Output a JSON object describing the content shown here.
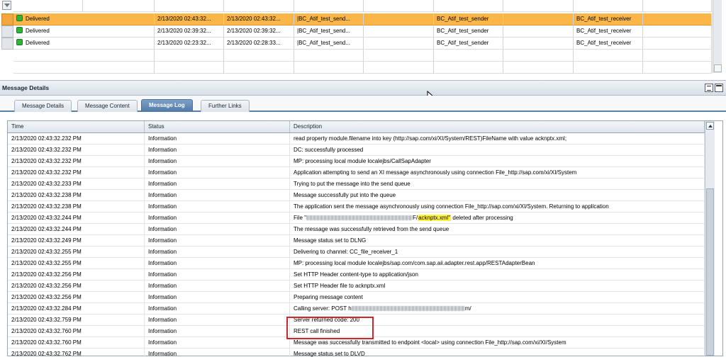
{
  "message_list": {
    "rows": [
      {
        "status": "Delivered",
        "start": "2/13/2020 02:43:32...",
        "end": "2/13/2020 02:43:32...",
        "interface": "|BC_Atif_test_send...",
        "sender": "BC_Atif_test_sender",
        "receiver": "BC_Atif_test_receiver",
        "selected": true
      },
      {
        "status": "Delivered",
        "start": "2/13/2020 02:39:32...",
        "end": "2/13/2020 02:39:32...",
        "interface": "|BC_Atif_test_send...",
        "sender": "BC_Atif_test_sender",
        "receiver": "BC_Atif_test_receiver",
        "selected": false
      },
      {
        "status": "Delivered",
        "start": "2/13/2020 02:23:32...",
        "end": "2/13/2020 02:28:33...",
        "interface": "|BC_Atif_test_send...",
        "sender": "BC_Atif_test_sender",
        "receiver": "BC_Atif_test_receiver",
        "selected": false
      }
    ]
  },
  "panel": {
    "title": "Message Details"
  },
  "tabs": [
    {
      "label": "Message Details",
      "active": false
    },
    {
      "label": "Message Content",
      "active": false
    },
    {
      "label": "Message Log",
      "active": true
    },
    {
      "label": "Further Links",
      "active": false
    }
  ],
  "log": {
    "headers": {
      "time": "Time",
      "status": "Status",
      "description": "Description"
    },
    "rows": [
      {
        "time": "2/13/2020 02:43:32.232 PM",
        "status": "Information",
        "desc": "read property module.filename into key (http://sap.com/xi/XI/System/REST)FileName with value acknptx.xml;"
      },
      {
        "time": "2/13/2020 02:43:32.232 PM",
        "status": "Information",
        "desc": "DC: successfully processed"
      },
      {
        "time": "2/13/2020 02:43:32.232 PM",
        "status": "Information",
        "desc": "MP: processing local module localejbs/CallSapAdapter"
      },
      {
        "time": "2/13/2020 02:43:32.232 PM",
        "status": "Information",
        "desc": "Application attempting to send an XI message asynchronously using connection File_http://sap.com/xi/XI/System"
      },
      {
        "time": "2/13/2020 02:43:32.233 PM",
        "status": "Information",
        "desc": "Trying to put the message into the send queue"
      },
      {
        "time": "2/13/2020 02:43:32.238 PM",
        "status": "Information",
        "desc": "Message successfully put into the queue"
      },
      {
        "time": "2/13/2020 02:43:32.238 PM",
        "status": "Information",
        "desc": "The application sent the message asynchronously using connection File_http://sap.com/xi/XI/System. Returning to application"
      },
      {
        "time": "2/13/2020 02:43:32.244 PM",
        "status": "Information",
        "desc_prefix": "File \"",
        "desc_suffix_pre": "F/",
        "desc_highlight": "acknptx.xml\"",
        "desc_suffix": " deleted after processing"
      },
      {
        "time": "2/13/2020 02:43:32.244 PM",
        "status": "Information",
        "desc": "The message was successfully retrieved from the send queue"
      },
      {
        "time": "2/13/2020 02:43:32.249 PM",
        "status": "Information",
        "desc": "Message status set to DLNG"
      },
      {
        "time": "2/13/2020 02:43:32.255 PM",
        "status": "Information",
        "desc": "Delivering to channel: CC_file_receiver_1"
      },
      {
        "time": "2/13/2020 02:43:32.255 PM",
        "status": "Information",
        "desc": "MP: processing local module localejbs/sap.com/com.sap.aii.adapter.rest.app/RESTAdapterBean"
      },
      {
        "time": "2/13/2020 02:43:32.256 PM",
        "status": "Information",
        "desc": "Set HTTP Header content-type to application/json"
      },
      {
        "time": "2/13/2020 02:43:32.256 PM",
        "status": "Information",
        "desc": "Set HTTP Header file to acknptx.xml"
      },
      {
        "time": "2/13/2020 02:43:32.256 PM",
        "status": "Information",
        "desc": "Preparing message content"
      },
      {
        "time": "2/13/2020 02:43:32.284 PM",
        "status": "Information",
        "desc_prefix": "Calling server: POST h",
        "desc_suffix": "m/"
      },
      {
        "time": "2/13/2020 02:43:32.759 PM",
        "status": "Information",
        "desc": "Server returned code: 200"
      },
      {
        "time": "2/13/2020 02:43:32.760 PM",
        "status": "Information",
        "desc": "REST call finished"
      },
      {
        "time": "2/13/2020 02:43:32.760 PM",
        "status": "Information",
        "desc": "Message was successfully transmitted to endpoint <local> using connection File_http://sap.com/xi/XI/System"
      },
      {
        "time": "2/13/2020 02:43:32.762 PM",
        "status": "Information",
        "desc": "Message status set to DLVD"
      }
    ]
  },
  "colors": {
    "selected_row": "#fbb647",
    "active_tab": "#4f79a8",
    "delivered_icon": "#2fb53c",
    "annotation_box": "#d0262b",
    "highlight": "#fff23a"
  }
}
